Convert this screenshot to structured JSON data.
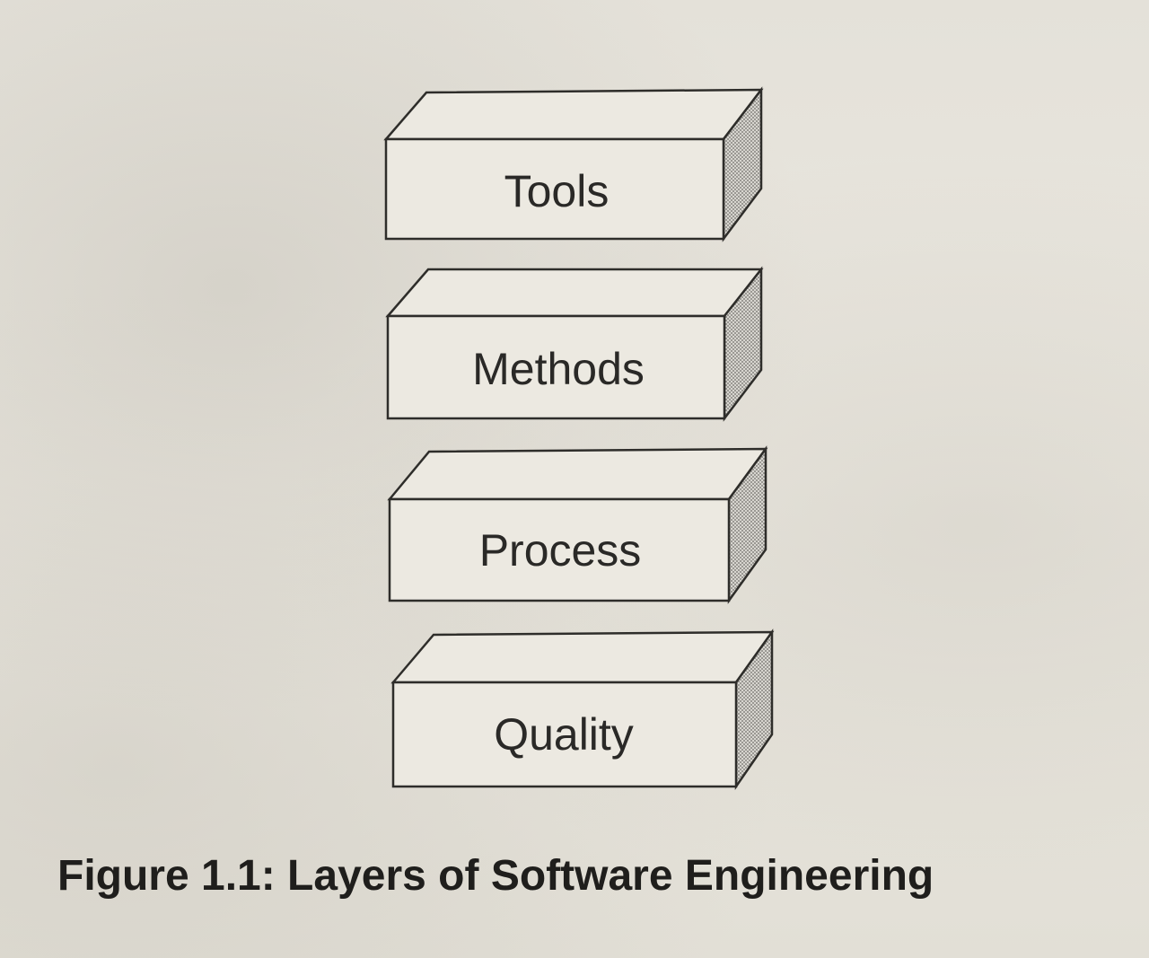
{
  "diagram": {
    "layers": [
      {
        "label": "Tools"
      },
      {
        "label": "Methods"
      },
      {
        "label": "Process"
      },
      {
        "label": "Quality"
      }
    ]
  },
  "caption": "Figure 1.1: Layers of Software Engineering"
}
